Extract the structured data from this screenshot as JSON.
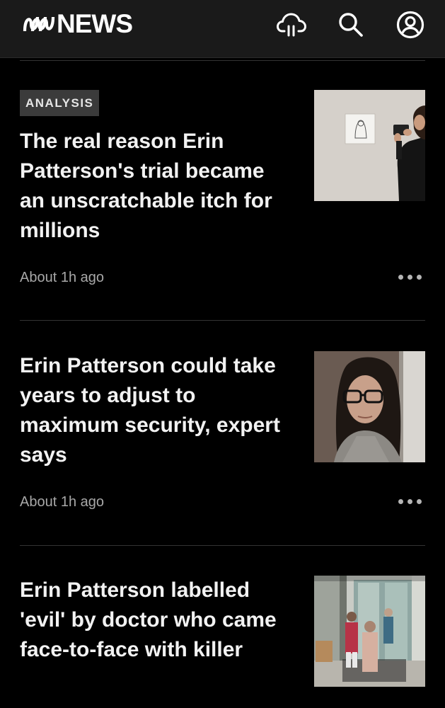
{
  "header": {
    "logo_text": "NEWS",
    "icons": [
      "abc-logo-icon",
      "weather-cloud-icon",
      "search-icon",
      "profile-icon"
    ]
  },
  "articles": [
    {
      "label": "ANALYSIS",
      "headline": "The real reason Erin Patterson's trial became an unscratchable itch for millions",
      "time": "About 1h ago",
      "image": "courtroom-sketch-photographer-photo"
    },
    {
      "label": "",
      "headline": "Erin Patterson could take years to adjust to maximum security, expert says",
      "time": "About 1h ago",
      "image": "erin-patterson-portrait-photo"
    },
    {
      "label": "",
      "headline": "Erin Patterson labelled 'evil' by doctor who came face-to-face with killer",
      "time": "",
      "image": "hospital-cctv-still-photo"
    }
  ],
  "colors": {
    "background": "#000000",
    "header": "#1a1a1a",
    "badge": "#3b3b3b",
    "timestamp": "#a8a8a8"
  }
}
